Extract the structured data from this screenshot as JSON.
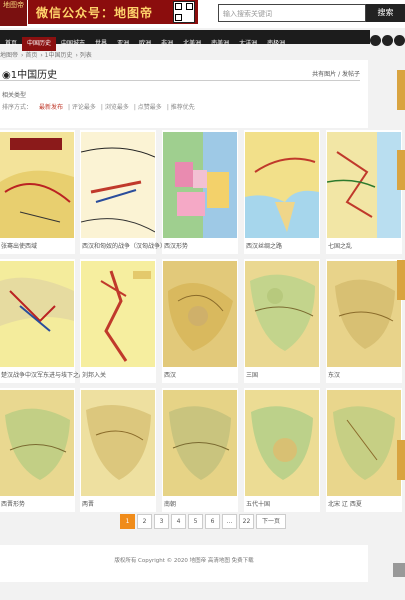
{
  "header": {
    "logo_text": "地图帝",
    "banner_text": "微信公众号：地图帝",
    "search_placeholder": "输入搜索关键词",
    "search_button": "搜索"
  },
  "nav": [
    "首页",
    "中国历史",
    "中国城市",
    "世界",
    "亚洲",
    "欧洲",
    "非洲",
    "北美洲",
    "南美洲",
    "大洋洲",
    "南极洲"
  ],
  "breadcrumb": [
    "地图帝",
    "首页",
    "1中国历史",
    "列表"
  ],
  "panel": {
    "title": "1中国历史",
    "meta": "共有图片 / 发帖子",
    "category_label": "相关类型",
    "sort_label": "排序方式：",
    "sort_options": [
      "最新发布",
      "评论最多",
      "浏览最多",
      "点赞最多",
      "推荐优先"
    ]
  },
  "cards": [
    {
      "caption": "张骞出使西域"
    },
    {
      "caption": "西汉和匈奴的战争（汉匈战争）"
    },
    {
      "caption": "西汉形势"
    },
    {
      "caption": "西汉丝绸之路"
    },
    {
      "caption": "七国之乱"
    },
    {
      "caption": "楚汉战争中汉军东进与垓下之战"
    },
    {
      "caption": "刘邦入关"
    },
    {
      "caption": "西汉"
    },
    {
      "caption": "三国"
    },
    {
      "caption": "东汉"
    },
    {
      "caption": "西晋形势"
    },
    {
      "caption": "两晋"
    },
    {
      "caption": "南朝"
    },
    {
      "caption": "五代十国"
    },
    {
      "caption": "北宋 辽 西夏"
    }
  ],
  "pagination": [
    "1",
    "2",
    "3",
    "4",
    "5",
    "6",
    "...",
    "22",
    "下一页"
  ],
  "footer": {
    "copyright": "版权所有 Copyright © 2020 地图帝 高清地图 免费下载"
  }
}
